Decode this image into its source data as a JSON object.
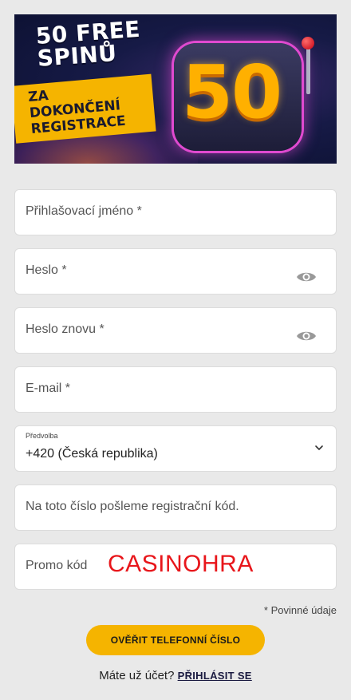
{
  "banner": {
    "headline_line1": "50 FREE",
    "headline_line2": "SPINŮ",
    "tag_line1": "ZA DOKONČENÍ",
    "tag_line2": "REGISTRACE",
    "big_number": "50"
  },
  "form": {
    "username_label": "Přihlašovací jméno *",
    "password_label": "Heslo *",
    "password_repeat_label": "Heslo znovu *",
    "email_label": "E-mail *",
    "prefix_caption": "Předvolba",
    "prefix_value": "+420 (Česká republika)",
    "phone_placeholder": "Na toto číslo pošleme registrační kód.",
    "promo_label": "Promo kód",
    "promo_value": "CASINOHRA",
    "required_note": "* Povinné údaje"
  },
  "actions": {
    "verify_button": "OVĚŘIT TELEFONNÍ ČÍSLO",
    "have_account": "Máte už účet?",
    "login_link": "PŘIHLÁSIT SE"
  },
  "colors": {
    "accent": "#f5b400",
    "promo_text": "#e8161b",
    "background": "#e9e9e9"
  },
  "icons": {
    "password_toggle": "eye-icon",
    "select_arrow": "chevron-down-icon"
  }
}
